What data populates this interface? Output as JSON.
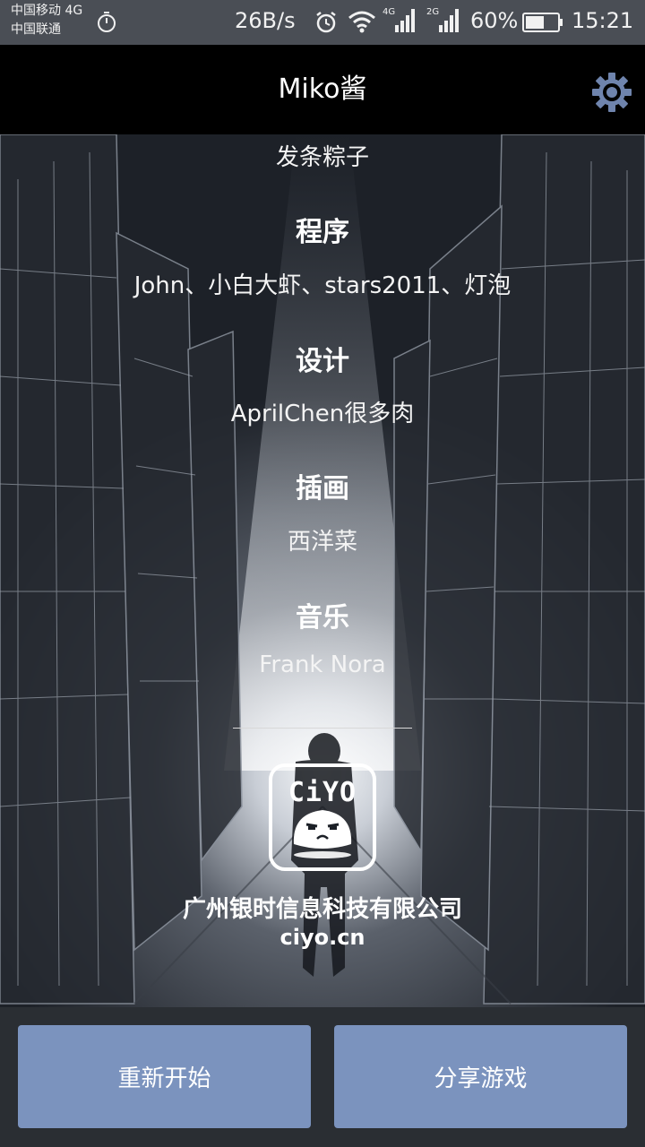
{
  "status_bar": {
    "carrier_1": "中国移动 4G",
    "carrier_2": "中国联通",
    "net_speed": "26B/s",
    "sig_label_1": "4G",
    "sig_label_2": "2G",
    "battery": "60%",
    "battery_level": 0.6,
    "time": "15:21",
    "icons": [
      "timer-icon",
      "alarm-icon",
      "wifi-icon",
      "signal-4g-icon",
      "signal-2g-icon",
      "battery-icon"
    ]
  },
  "header": {
    "title": "Miko酱",
    "settings_icon": "gear-icon",
    "accent": "#6f84ad"
  },
  "credits": {
    "partial_top": "发条粽子",
    "sections": [
      {
        "heading": "程序",
        "value": "John、小白大虾、stars2011、灯泡"
      },
      {
        "heading": "设计",
        "value": "AprilChen很多肉"
      },
      {
        "heading": "插画",
        "value": "西洋菜"
      },
      {
        "heading": "音乐",
        "value": "Frank Nora"
      }
    ]
  },
  "footer": {
    "logo_text": "CiYO",
    "company": "广州银时信息科技有限公司",
    "website": "ciyo.cn"
  },
  "actions": {
    "restart_label": "重新开始",
    "share_label": "分享游戏",
    "button_color": "#7b93be"
  }
}
